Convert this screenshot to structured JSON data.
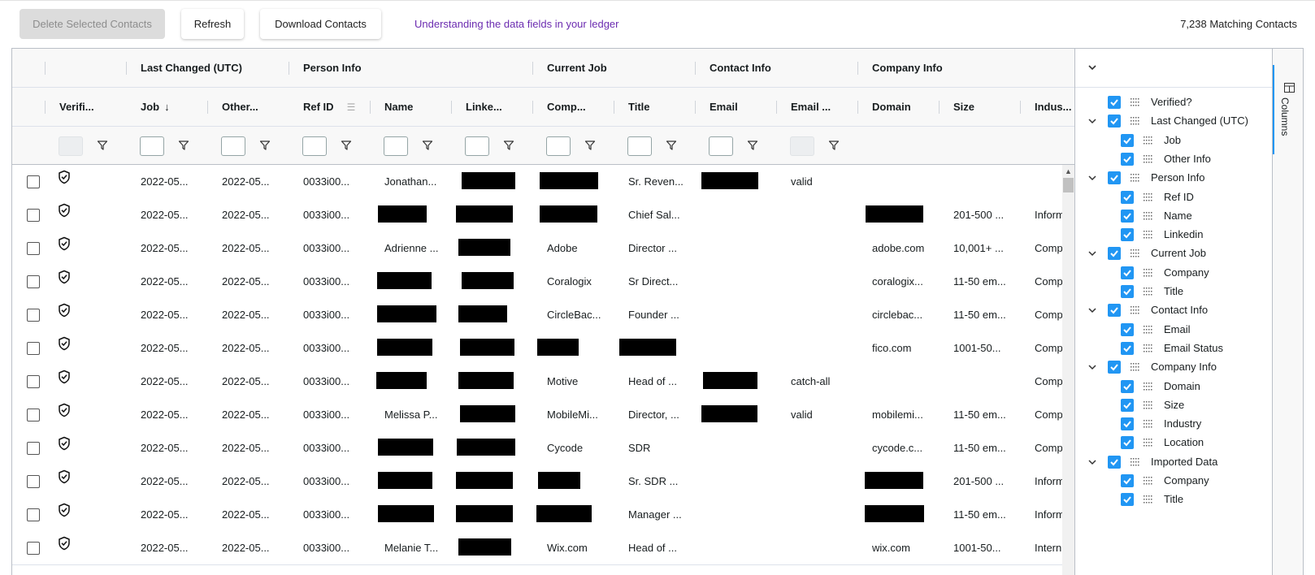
{
  "toolbar": {
    "delete_label": "Delete Selected Contacts",
    "refresh_label": "Refresh",
    "download_label": "Download Contacts",
    "help_link": "Understanding the data fields in your ledger",
    "match_count": "7,238 Matching Contacts"
  },
  "group_headers": [
    "Last Changed (UTC)",
    "Person Info",
    "Current Job",
    "Contact Info",
    "Company Info"
  ],
  "columns": [
    "Verifi...",
    "Job",
    "Other...",
    "Ref ID",
    "Name",
    "Linke...",
    "Comp...",
    "Title",
    "Email",
    "Email ...",
    "Domain",
    "Size",
    "Indus..."
  ],
  "sort": {
    "column": "Job",
    "direction": "descending"
  },
  "rows": [
    {
      "job": "2022-05...",
      "other": "2022-05...",
      "ref": "0033i00...",
      "name": "Jonathan...",
      "company": "",
      "title": "Sr. Reven...",
      "email_status": "valid",
      "domain": "",
      "size": "",
      "industry": ""
    },
    {
      "job": "2022-05...",
      "other": "2022-05...",
      "ref": "0033i00...",
      "name": "",
      "company": "",
      "title": "Chief Sal...",
      "email_status": "",
      "domain": "",
      "size": "201-500 ...",
      "industry": "Inform"
    },
    {
      "job": "2022-05...",
      "other": "2022-05...",
      "ref": "0033i00...",
      "name": "Adrienne ...",
      "company": "Adobe",
      "title": "Director ...",
      "email_status": "",
      "domain": "adobe.com",
      "size": "10,001+ ...",
      "industry": "Comp"
    },
    {
      "job": "2022-05...",
      "other": "2022-05...",
      "ref": "0033i00...",
      "name": "",
      "company": "Coralogix",
      "title": "Sr Direct...",
      "email_status": "",
      "domain": "coralogix...",
      "size": "11-50 em...",
      "industry": "Comp"
    },
    {
      "job": "2022-05...",
      "other": "2022-05...",
      "ref": "0033i00...",
      "name": "",
      "company": "CircleBac...",
      "title": "Founder ...",
      "email_status": "",
      "domain": "circlebac...",
      "size": "11-50 em...",
      "industry": "Comp"
    },
    {
      "job": "2022-05...",
      "other": "2022-05...",
      "ref": "0033i00...",
      "name": "",
      "company": "",
      "title": "",
      "email_status": "",
      "domain": "fico.com",
      "size": "1001-50...",
      "industry": "Comp"
    },
    {
      "job": "2022-05...",
      "other": "2022-05...",
      "ref": "0033i00...",
      "name": "",
      "company": "Motive",
      "title": "Head of ...",
      "email_status": "catch-all",
      "domain": "",
      "size": "",
      "industry": "Comp"
    },
    {
      "job": "2022-05...",
      "other": "2022-05...",
      "ref": "0033i00...",
      "name": "Melissa P...",
      "company": "MobileMi...",
      "title": "Director, ...",
      "email_status": "valid",
      "domain": "mobilemi...",
      "size": "11-50 em...",
      "industry": "Comp"
    },
    {
      "job": "2022-05...",
      "other": "2022-05...",
      "ref": "0033i00...",
      "name": "",
      "company": "Cycode",
      "title": "SDR",
      "email_status": "",
      "domain": "cycode.c...",
      "size": "11-50 em...",
      "industry": "Comp"
    },
    {
      "job": "2022-05...",
      "other": "2022-05...",
      "ref": "0033i00...",
      "name": "",
      "company": "",
      "title": "Sr. SDR ...",
      "email_status": "",
      "domain": "",
      "size": "201-500 ...",
      "industry": "Inform"
    },
    {
      "job": "2022-05...",
      "other": "2022-05...",
      "ref": "0033i00...",
      "name": "",
      "company": "",
      "title": "Manager ...",
      "email_status": "",
      "domain": "",
      "size": "11-50 em...",
      "industry": "Inform"
    },
    {
      "job": "2022-05...",
      "other": "2022-05...",
      "ref": "0033i00...",
      "name": "Melanie T...",
      "company": "Wix.com",
      "title": "Head of ...",
      "email_status": "",
      "domain": "wix.com",
      "size": "1001-50...",
      "industry": "Intern"
    }
  ],
  "column_panel": {
    "tab_label": "Columns",
    "items": [
      {
        "label": "Verified?",
        "level": 0,
        "group": false
      },
      {
        "label": "Last Changed (UTC)",
        "level": 0,
        "group": true
      },
      {
        "label": "Job",
        "level": 1,
        "group": false
      },
      {
        "label": "Other Info",
        "level": 1,
        "group": false
      },
      {
        "label": "Person Info",
        "level": 0,
        "group": true
      },
      {
        "label": "Ref ID",
        "level": 1,
        "group": false
      },
      {
        "label": "Name",
        "level": 1,
        "group": false
      },
      {
        "label": "Linkedin",
        "level": 1,
        "group": false
      },
      {
        "label": "Current Job",
        "level": 0,
        "group": true
      },
      {
        "label": "Company",
        "level": 1,
        "group": false
      },
      {
        "label": "Title",
        "level": 1,
        "group": false
      },
      {
        "label": "Contact Info",
        "level": 0,
        "group": true
      },
      {
        "label": "Email",
        "level": 1,
        "group": false
      },
      {
        "label": "Email Status",
        "level": 1,
        "group": false
      },
      {
        "label": "Company Info",
        "level": 0,
        "group": true
      },
      {
        "label": "Domain",
        "level": 1,
        "group": false
      },
      {
        "label": "Size",
        "level": 1,
        "group": false
      },
      {
        "label": "Industry",
        "level": 1,
        "group": false
      },
      {
        "label": "Location",
        "level": 1,
        "group": false
      },
      {
        "label": "Imported Data",
        "level": 0,
        "group": true
      },
      {
        "label": "Company",
        "level": 1,
        "group": false
      },
      {
        "label": "Title",
        "level": 1,
        "group": false
      }
    ]
  },
  "colors": {
    "accent": "#2196f3",
    "link": "#6b2bb0",
    "redaction": "#000000"
  }
}
